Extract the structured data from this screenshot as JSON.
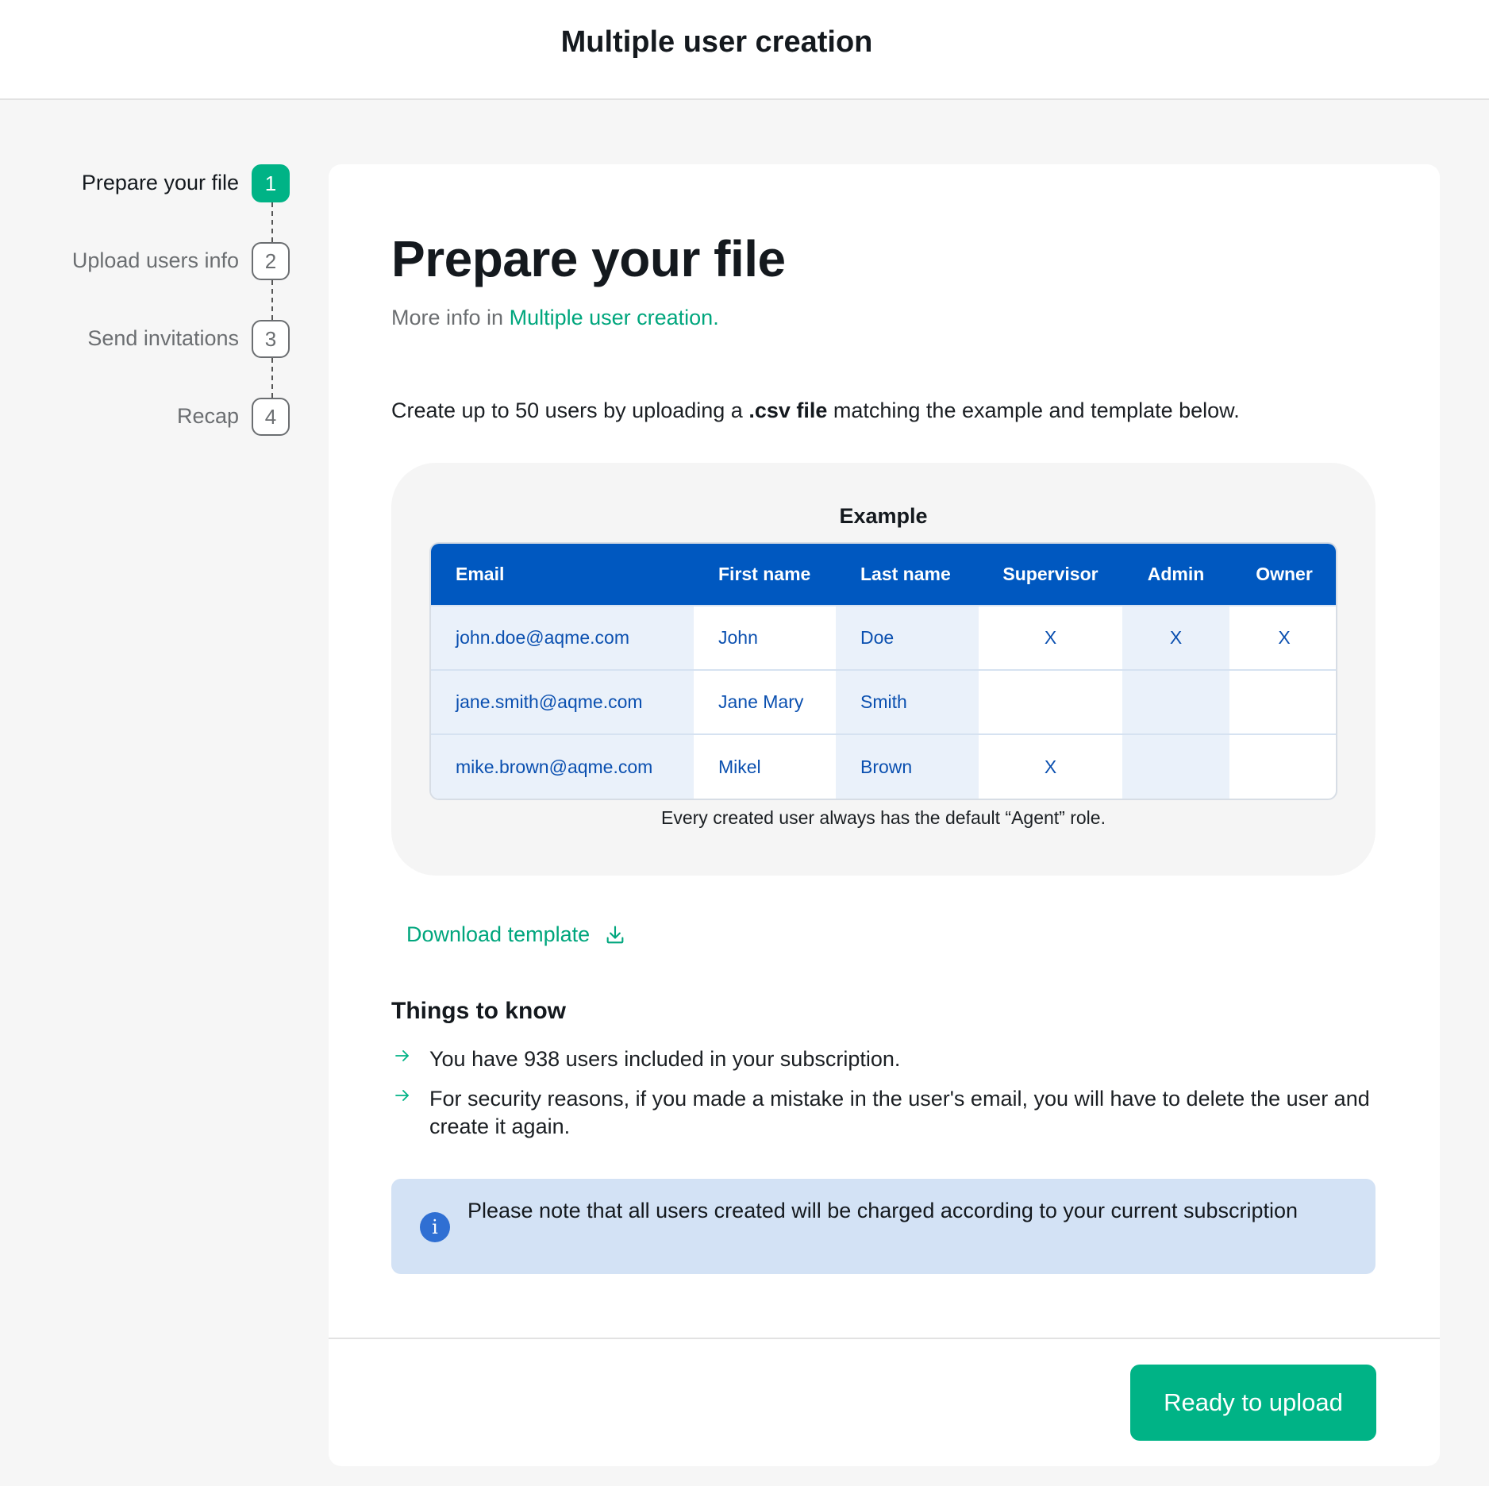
{
  "header": {
    "title": "Multiple user creation"
  },
  "stepper": {
    "steps": [
      {
        "label": "Prepare your file",
        "number": "1",
        "state": "active"
      },
      {
        "label": "Upload users info",
        "number": "2",
        "state": "pending"
      },
      {
        "label": "Send invitations",
        "number": "3",
        "state": "pending"
      },
      {
        "label": "Recap",
        "number": "4",
        "state": "pending"
      }
    ]
  },
  "main": {
    "title": "Prepare your file",
    "more_info_prefix": "More info in ",
    "more_info_link": "Multiple user creation.",
    "intro_before": "Create up to 50 users by uploading a ",
    "intro_bold": ".csv file",
    "intro_after": " matching the example and template below.",
    "example": {
      "title": "Example",
      "columns": [
        "Email",
        "First name",
        "Last name",
        "Supervisor",
        "Admin",
        "Owner"
      ],
      "rows": [
        [
          "john.doe@aqme.com",
          "John",
          "Doe",
          "X",
          "X",
          "X"
        ],
        [
          "jane.smith@aqme.com",
          "Jane Mary",
          "Smith",
          "",
          "",
          ""
        ],
        [
          "mike.brown@aqme.com",
          "Mikel",
          "Brown",
          "X",
          "",
          ""
        ]
      ],
      "note": "Every created user always has the default “Agent” role."
    },
    "download_label": "Download template",
    "things_to_know": {
      "title": "Things to know",
      "items": [
        "You have 938 users included in your subscription.",
        "For security reasons, if you made a mistake in the user's email, you will have to delete the user and create it again."
      ]
    },
    "notice": {
      "icon": "info-icon",
      "text": "Please note that all users created will be charged according to your current subscription"
    },
    "primary_button": "Ready to upload"
  },
  "colors": {
    "accent_green": "#00b386",
    "table_header_blue": "#0058c0",
    "notice_background": "#d3e2f5"
  }
}
